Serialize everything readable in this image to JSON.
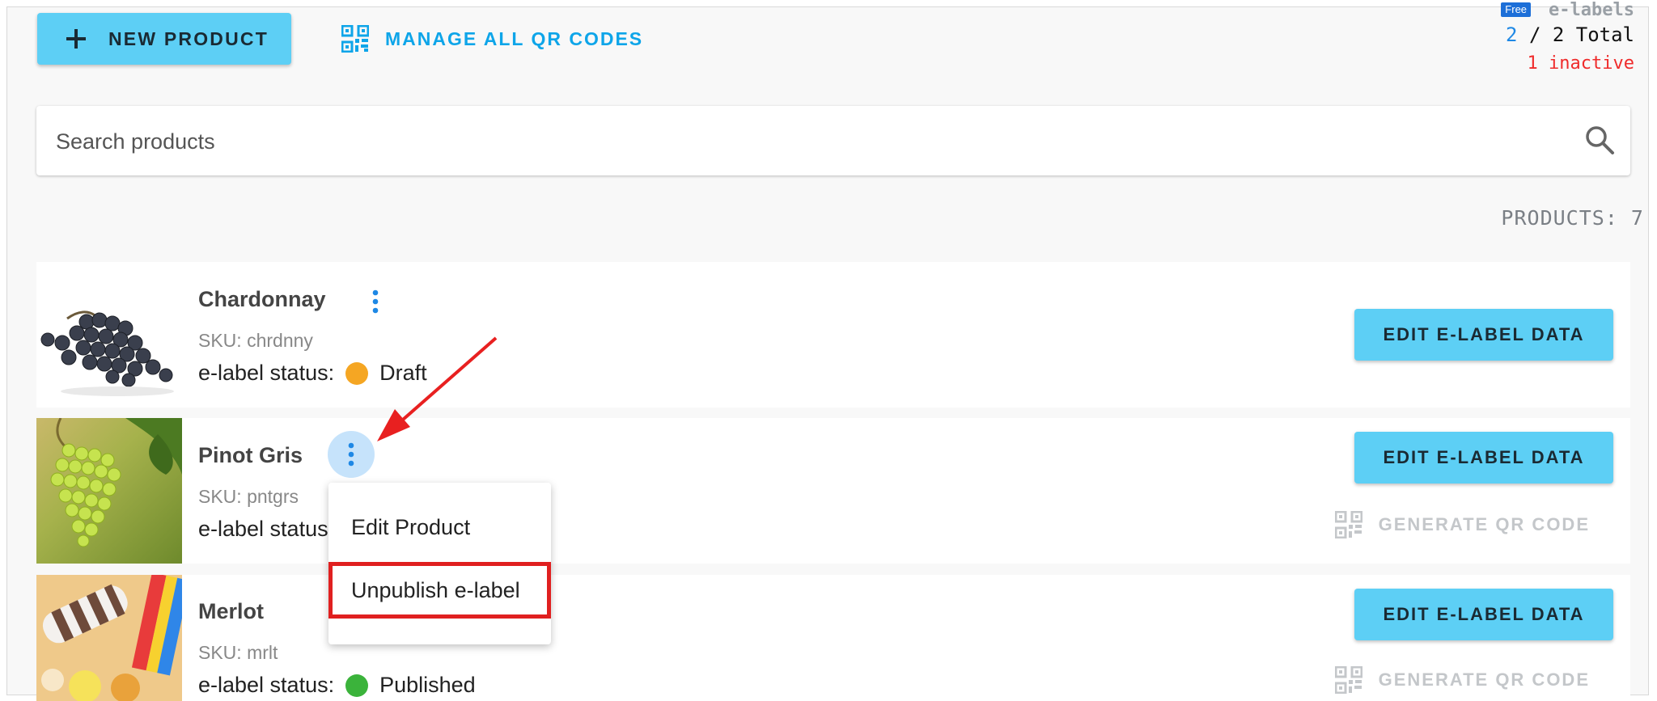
{
  "header": {
    "new_product_label": "NEW PRODUCT",
    "manage_qr_label": "MANAGE ALL QR CODES",
    "plan_badge": "Free",
    "elabels_label": "e-labels",
    "count_current": "2",
    "count_total_text": " / 2 Total",
    "inactive_text": "1 inactive"
  },
  "search": {
    "placeholder": "Search products"
  },
  "products_count_label": "PRODUCTS: 7",
  "products": [
    {
      "name": "Chardonnay",
      "sku": "SKU: chrdnny",
      "status_label": "e-label status:",
      "status": "Draft",
      "status_color": "#f5a623",
      "edit_label": "EDIT E-LABEL DATA",
      "generate_label": ""
    },
    {
      "name": "Pinot Gris",
      "sku": "SKU: pntgrs",
      "status_label": "e-label status:",
      "status": "",
      "status_color": "",
      "edit_label": "EDIT E-LABEL DATA",
      "generate_label": "GENERATE QR CODE"
    },
    {
      "name": "Merlot",
      "sku": "SKU: mrlt",
      "status_label": "e-label status:",
      "status": "Published",
      "status_color": "#3bb33b",
      "edit_label": "EDIT E-LABEL DATA",
      "generate_label": "GENERATE QR CODE"
    }
  ],
  "context_menu": {
    "items": [
      {
        "label": "Edit Product"
      },
      {
        "label": "Unpublish e-label"
      }
    ]
  },
  "colors": {
    "accent": "#5dcff5",
    "link": "#0ea5e9",
    "highlight": "#e02020"
  }
}
